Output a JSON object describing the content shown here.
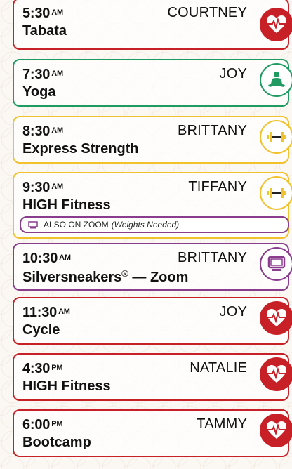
{
  "colors": {
    "red": "#c72026",
    "green": "#1f9b62",
    "yellow": "#f2c12e",
    "purple": "#8a3d8d"
  },
  "classes": [
    {
      "time": "5:30",
      "ampm": "AM",
      "instructor": "COURTNEY",
      "name": "Tabata",
      "icon": "heart-icon",
      "color": "red"
    },
    {
      "time": "7:30",
      "ampm": "AM",
      "instructor": "JOY",
      "name": "Yoga",
      "icon": "meditation-icon",
      "color": "green"
    },
    {
      "time": "8:30",
      "ampm": "AM",
      "instructor": "BRITTANY",
      "name": "Express Strength",
      "icon": "dumbbell-icon",
      "color": "yellow"
    },
    {
      "time": "9:30",
      "ampm": "AM",
      "instructor": "TIFFANY",
      "name": "HIGH Fitness",
      "icon": "dumbbell-icon",
      "color": "yellow",
      "zoom": {
        "label": "ALSO ON ZOOM",
        "note": "(Weights Needed)"
      }
    },
    {
      "time": "10:30",
      "ampm": "AM",
      "instructor": "BRITTANY",
      "name": "Silversneakers",
      "name_sup": "®",
      "name_suffix": " — Zoom",
      "icon": "monitor-icon",
      "color": "purple"
    },
    {
      "time": "11:30",
      "ampm": "AM",
      "instructor": "JOY",
      "name": "Cycle",
      "icon": "heart-icon",
      "color": "red"
    },
    {
      "time": "4:30",
      "ampm": "PM",
      "instructor": "NATALIE",
      "name": "HIGH Fitness",
      "icon": "heart-icon",
      "color": "red"
    },
    {
      "time": "6:00",
      "ampm": "PM",
      "instructor": "TAMMY",
      "name": "Bootcamp",
      "icon": "heart-icon",
      "color": "red"
    }
  ]
}
